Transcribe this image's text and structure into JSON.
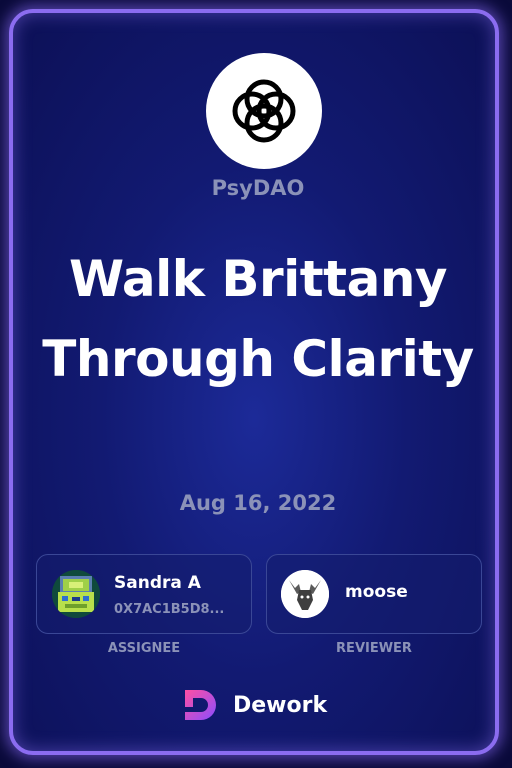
{
  "organization": {
    "name": "PsyDAO",
    "logo_icon": "psydao-logo-icon"
  },
  "task": {
    "title": "Walk Brittany Through Clarity",
    "date": "Aug 16, 2022"
  },
  "assignee": {
    "name": "Sandra A",
    "address": "0X7AC1B5D8...",
    "role_label": "ASSIGNEE",
    "avatar_icon": "nft-avatar-icon"
  },
  "reviewer": {
    "name": "moose",
    "role_label": "REVIEWER",
    "avatar_icon": "moose-avatar-icon"
  },
  "brand": {
    "name": "Dework",
    "logo_icon": "dework-logo-icon"
  },
  "colors": {
    "background": "#121a72",
    "border_glow": "#8b6cf0",
    "muted_text": "#8b92b8",
    "text": "#ffffff"
  }
}
